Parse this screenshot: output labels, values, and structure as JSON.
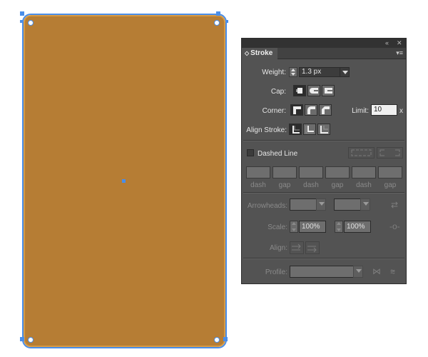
{
  "canvas": {
    "shape_fill": "#b67d34",
    "selection_color": "#4a8ee8"
  },
  "panel": {
    "collapse_icon": "double-chevron-left-icon",
    "close_icon": "close-icon",
    "tab_label": "Stroke",
    "menu_icon": "panel-menu-icon",
    "weight": {
      "label": "Weight:",
      "value": "1.3 px"
    },
    "cap": {
      "label": "Cap:",
      "selected": "butt"
    },
    "corner": {
      "label": "Corner:",
      "selected": "miter",
      "limit_label": "Limit:",
      "limit_value": "10",
      "limit_suffix": "x"
    },
    "align_stroke": {
      "label": "Align Stroke:",
      "selected": "center"
    },
    "dashed": {
      "label": "Dashed Line",
      "checked": false
    },
    "dash_gap_labels": [
      "dash",
      "gap",
      "dash",
      "gap",
      "dash",
      "gap"
    ],
    "arrowheads": {
      "label": "Arrowheads:"
    },
    "scale": {
      "label": "Scale:",
      "start": "100%",
      "end": "100%"
    },
    "align": {
      "label": "Align:"
    },
    "profile": {
      "label": "Profile:"
    }
  }
}
